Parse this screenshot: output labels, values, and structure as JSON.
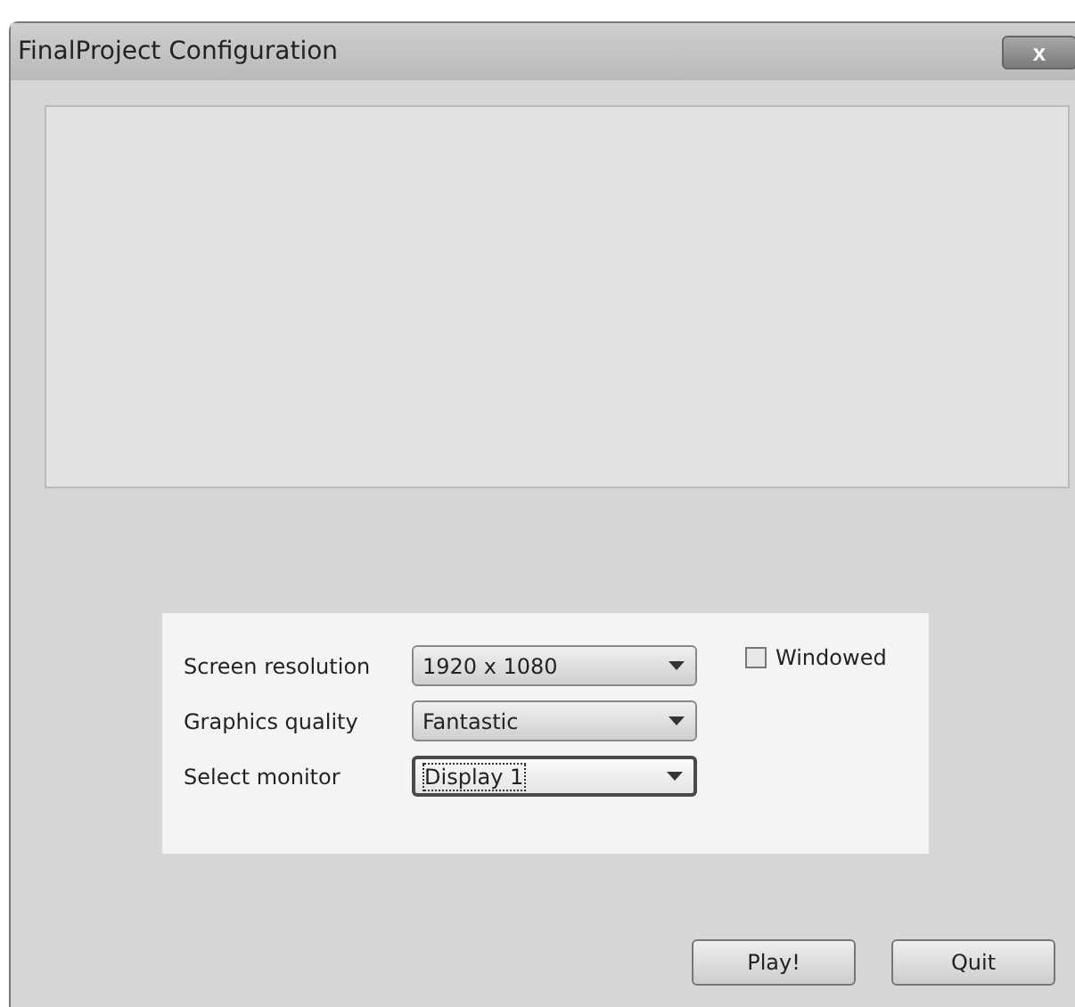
{
  "window": {
    "title": "FinalProject Configuration",
    "close": "x"
  },
  "settings": [
    {
      "label": "Screen resolution",
      "value": "1920 x 1080",
      "focused": false
    },
    {
      "label": "Graphics quality",
      "value": "Fantastic",
      "focused": false
    },
    {
      "label": "Select monitor",
      "value": "Display 1",
      "focused": true
    }
  ],
  "windowed": {
    "label": "Windowed",
    "checked": false
  },
  "buttons": [
    "Play!",
    "Quit"
  ]
}
